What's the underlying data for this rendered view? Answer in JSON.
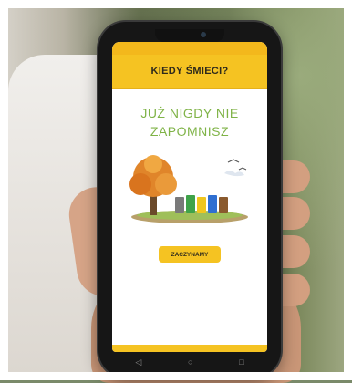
{
  "phone": {
    "status_time": "",
    "status_icons": "",
    "header_title": "KIEDY ŚMIECI?",
    "headline_line1": "JUŻ NIGDY NIE",
    "headline_line2": "ZAPOMNISZ",
    "start_button": "ZACZYNAMY",
    "nav_back": "◁",
    "nav_home": "○",
    "nav_recent": "□"
  },
  "colors": {
    "brand_yellow": "#f5c322",
    "headline_green": "#7fb347"
  },
  "icons": {
    "illustration": "tree-and-waste-bins-illustration"
  }
}
